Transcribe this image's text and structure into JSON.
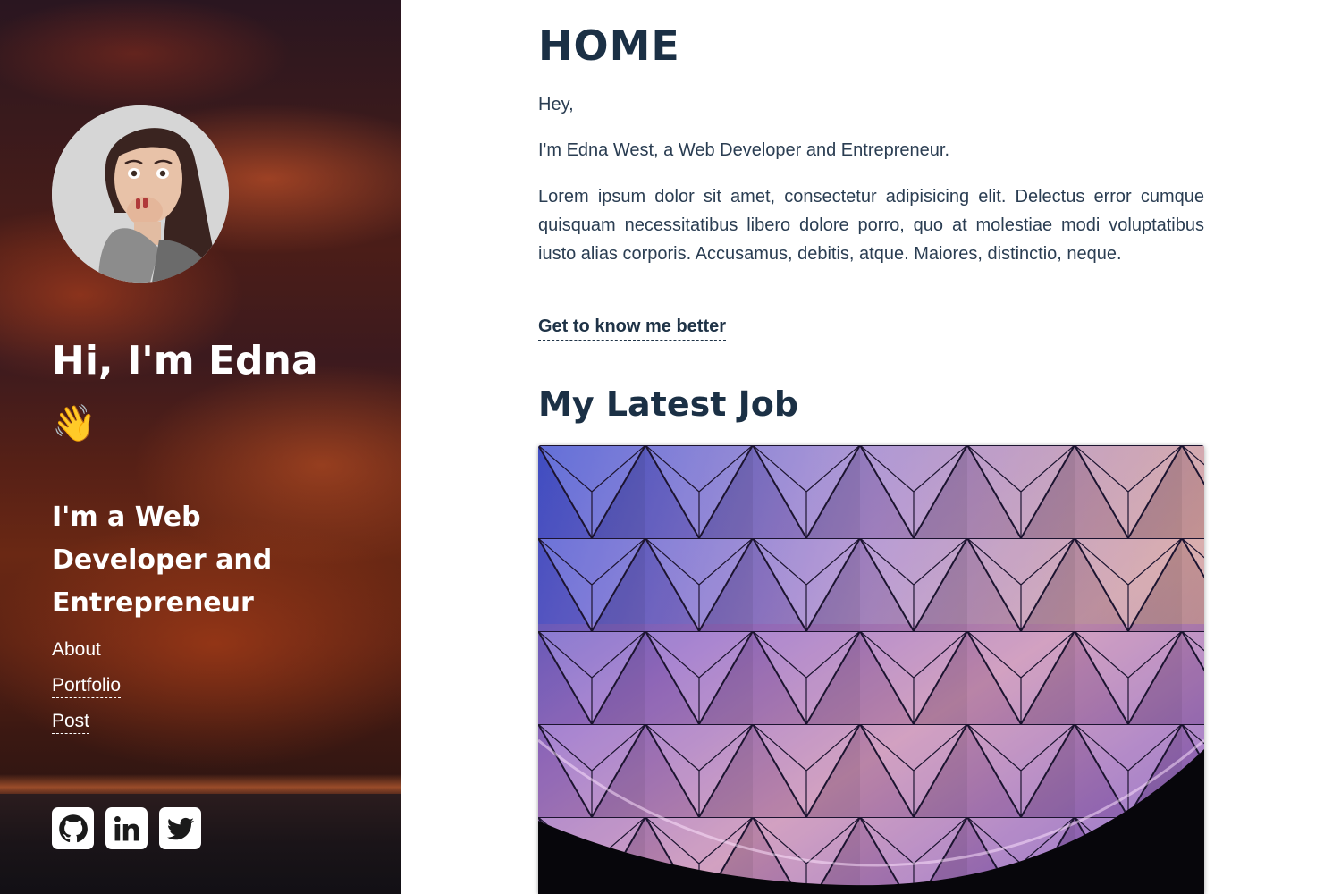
{
  "sidebar": {
    "greeting": "Hi, I'm Edna",
    "wave_emoji": "👋",
    "tagline": "I'm a Web Developer and Entrepreneur",
    "nav": [
      {
        "label": "About"
      },
      {
        "label": "Portfolio"
      },
      {
        "label": "Post"
      }
    ],
    "social": [
      {
        "icon": "github-icon"
      },
      {
        "icon": "linkedin-icon"
      },
      {
        "icon": "twitter-icon"
      }
    ]
  },
  "main": {
    "title": "HOME",
    "greeting": "Hey,",
    "intro": "I'm Edna West, a Web Developer and Entrepreneur.",
    "body": "Lorem ipsum dolor sit amet, consectetur adipisicing elit. Delectus error cumque quisquam necessitatibus libero dolore porro, quo at molestiae modi voluptatibus iusto alias corporis. Accusamus, debitis, atque. Maiores, distinctio, neque.",
    "cta": "Get to know me better",
    "latest_job_heading": "My Latest Job"
  },
  "colors": {
    "heading": "#1b3045",
    "text": "#2a3d52",
    "sidebar_text": "#ffffff"
  }
}
